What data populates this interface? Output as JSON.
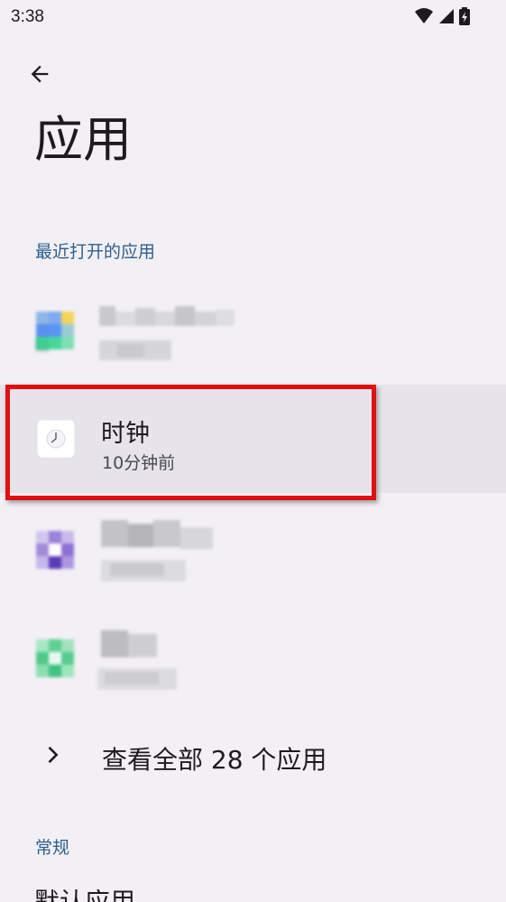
{
  "status_bar": {
    "time": "3:38"
  },
  "header": {
    "title": "应用"
  },
  "recent_section": {
    "title": "最近打开的应用",
    "apps": [
      {
        "name": "",
        "time": "",
        "icon": "blurred-app-icon-1"
      },
      {
        "name": "时钟",
        "time": "10分钟前",
        "icon": "clock-icon"
      },
      {
        "name": "",
        "time": "",
        "icon": "blurred-app-icon-2"
      },
      {
        "name": "",
        "time": "",
        "icon": "blurred-app-icon-3"
      }
    ],
    "see_all_label": "查看全部 28 个应用"
  },
  "general_section": {
    "title": "常规",
    "first_item": "默认应用"
  },
  "colors": {
    "background": "#f2f0f5",
    "section_header": "#2d5f8f",
    "highlight": "#e01010"
  }
}
